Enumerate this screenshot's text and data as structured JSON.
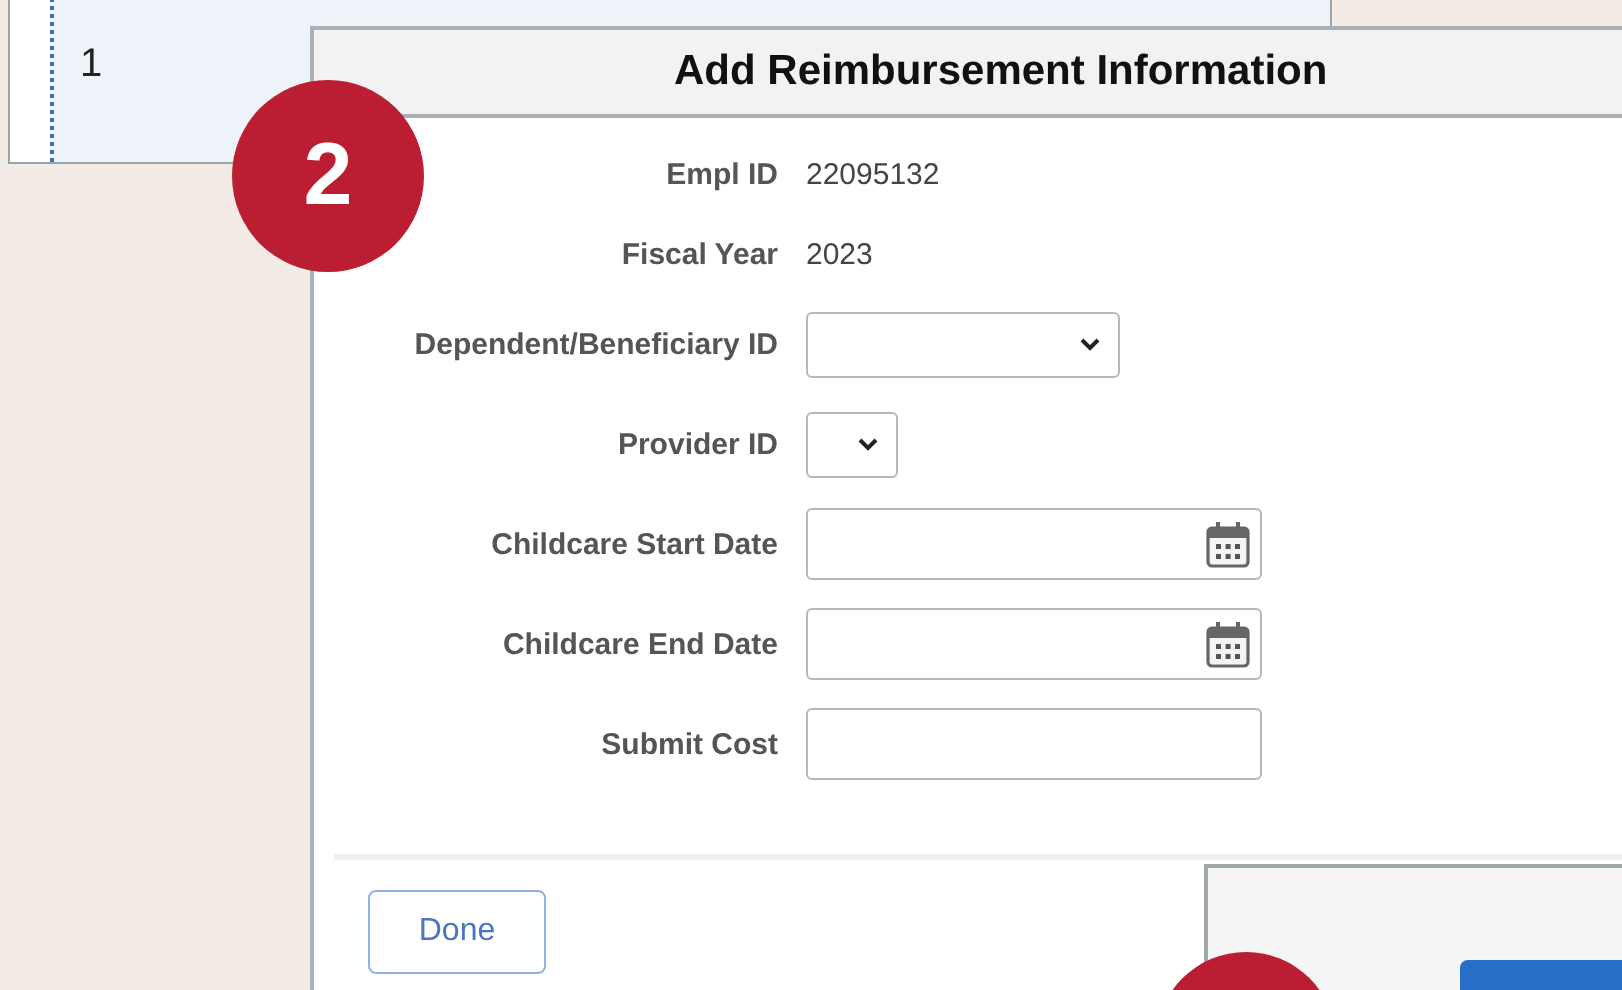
{
  "background_table": {
    "rows": [
      {
        "cells": [
          "1"
        ]
      }
    ]
  },
  "dialog": {
    "title": "Add Reimbursement Information",
    "fields": [
      {
        "kind": "readonly",
        "label": "Empl ID",
        "value": "22095132"
      },
      {
        "kind": "readonly",
        "label": "Fiscal Year",
        "value": "2023"
      },
      {
        "kind": "select",
        "label": "Dependent/Beneficiary ID"
      },
      {
        "kind": "compact-select",
        "label": "Provider ID"
      },
      {
        "kind": "date",
        "label": "Childcare Start Date"
      },
      {
        "kind": "date",
        "label": "Childcare End Date"
      },
      {
        "kind": "text",
        "label": "Submit Cost"
      }
    ],
    "buttons": [
      "Done"
    ]
  },
  "callout": {
    "label": "2"
  }
}
